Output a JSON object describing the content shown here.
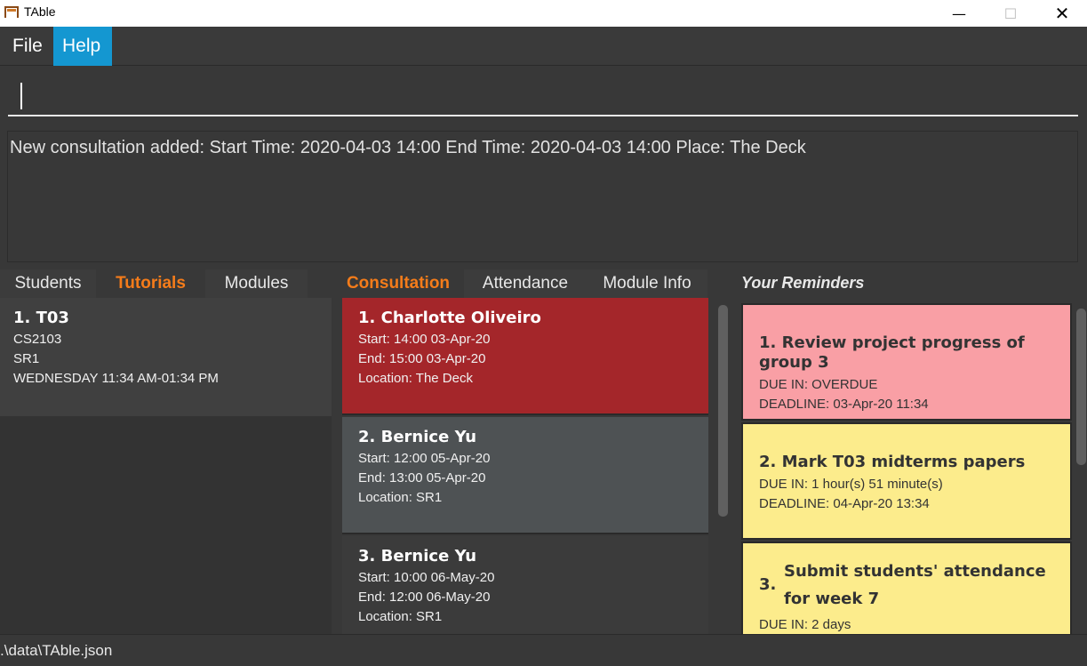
{
  "window": {
    "title": "TAble",
    "minimize": "—",
    "maximize": "☐",
    "close": "✕"
  },
  "menu": {
    "file": "File",
    "help": "Help"
  },
  "command": {
    "value": ""
  },
  "result": {
    "text": "New consultation added:  Start Time: 2020-04-03 14:00 End Time: 2020-04-03 14:00 Place: The Deck"
  },
  "left_panel": {
    "tabs": [
      "Students",
      "Tutorials",
      "Modules"
    ],
    "active_tab": "Tutorials",
    "tutorial": {
      "heading": "1.  T03",
      "module": "CS2103",
      "venue": "SR1",
      "time": "WEDNESDAY 11:34 AM-01:34 PM"
    }
  },
  "mid_panel": {
    "tabs": [
      "Consultation",
      "Attendance",
      "Module Info"
    ],
    "active_tab": "Consultation",
    "consultations": [
      {
        "heading": "1.  Charlotte Oliveiro",
        "start": "Start: 14:00 03-Apr-20",
        "end": "End: 15:00 03-Apr-20",
        "location": "Location: The Deck",
        "color": "#a4262a"
      },
      {
        "heading": "2.  Bernice Yu",
        "start": "Start: 12:00 05-Apr-20",
        "end": "End: 13:00 05-Apr-20",
        "location": "Location: SR1",
        "color": "#4e5254"
      },
      {
        "heading": "3.  Bernice Yu",
        "start": "Start: 10:00 06-May-20",
        "end": "End: 12:00 06-May-20",
        "location": "Location: SR1",
        "color": "#3b3b3b"
      }
    ]
  },
  "right_panel": {
    "title": "Your Reminders",
    "reminders": [
      {
        "heading": "1.  Review project progress of group 3",
        "due": "DUE IN: OVERDUE",
        "deadline": "DEADLINE: 03-Apr-20 11:34",
        "color": "#f99fa5"
      },
      {
        "heading": "2.  Mark T03 midterms papers",
        "due": "DUE IN: 1 hour(s) 51 minute(s)",
        "deadline": "DEADLINE: 04-Apr-20 13:34",
        "color": "#fcec8c"
      },
      {
        "heading_num": "3.",
        "heading": "Submit students' attendance for week 7",
        "due": "DUE IN: 2 days",
        "deadline": "",
        "color": "#fcec8c"
      }
    ]
  },
  "status": {
    "path": ".\\data\\TAble.json"
  }
}
